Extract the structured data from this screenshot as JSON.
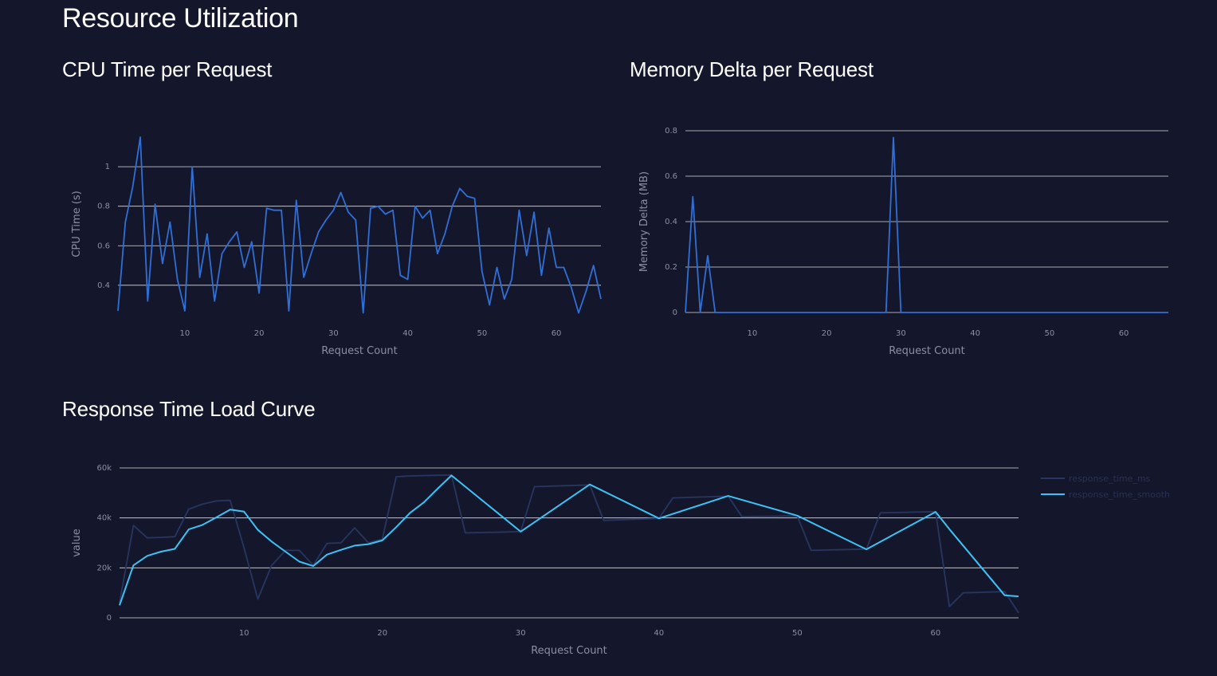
{
  "page": {
    "title": "Resource Utilization"
  },
  "colors": {
    "background": "#14172b",
    "grid": "#ffffff",
    "tick_text": "#8a8fa3",
    "cpu_line": "#2f6fd6",
    "memory_line": "#2f6fd6",
    "response_raw": "#27365f",
    "response_smooth": "#3cc3f5"
  },
  "panels": {
    "cpu": {
      "title": "CPU Time per Request"
    },
    "memory": {
      "title": "Memory Delta per Request"
    },
    "response": {
      "title": "Response Time Load Curve"
    }
  },
  "chart_data": [
    {
      "id": "cpu",
      "type": "line",
      "title": "CPU Time per Request",
      "xlabel": "Request Count",
      "ylabel": "CPU Time (s)",
      "xlim": [
        1,
        66
      ],
      "ylim": [
        0.27,
        1.15
      ],
      "xticks": [
        10,
        20,
        30,
        40,
        50,
        60
      ],
      "yticks": [
        0.4,
        0.6,
        0.8,
        1
      ],
      "ytick_labels": [
        "0.4",
        "0.6",
        "0.8",
        "1"
      ],
      "grid": true,
      "series": [
        {
          "color": "#2f6fd6",
          "x": [
            1,
            2,
            3,
            4,
            5,
            6,
            7,
            8,
            9,
            10,
            11,
            12,
            13,
            14,
            15,
            16,
            17,
            18,
            19,
            20,
            21,
            22,
            23,
            24,
            25,
            26,
            27,
            28,
            29,
            30,
            31,
            32,
            33,
            34,
            35,
            36,
            37,
            38,
            39,
            40,
            41,
            42,
            43,
            44,
            45,
            46,
            47,
            48,
            49,
            50,
            51,
            52,
            53,
            54,
            55,
            56,
            57,
            58,
            59,
            60,
            61,
            62,
            63,
            64,
            65,
            66
          ],
          "y": [
            0.27,
            0.72,
            0.9,
            1.15,
            0.32,
            0.81,
            0.51,
            0.72,
            0.43,
            0.27,
            1.0,
            0.44,
            0.66,
            0.32,
            0.56,
            0.62,
            0.67,
            0.49,
            0.62,
            0.36,
            0.79,
            0.78,
            0.78,
            0.27,
            0.83,
            0.44,
            0.56,
            0.67,
            0.73,
            0.78,
            0.87,
            0.77,
            0.73,
            0.26,
            0.79,
            0.8,
            0.76,
            0.78,
            0.45,
            0.43,
            0.8,
            0.74,
            0.78,
            0.56,
            0.66,
            0.8,
            0.89,
            0.85,
            0.84,
            0.47,
            0.3,
            0.49,
            0.33,
            0.43,
            0.78,
            0.55,
            0.77,
            0.45,
            0.69,
            0.49,
            0.49,
            0.39,
            0.26,
            0.37,
            0.5,
            0.33
          ]
        }
      ]
    },
    {
      "id": "memory",
      "type": "line",
      "title": "Memory Delta per Request",
      "xlabel": "Request Count",
      "ylabel": "Memory Delta (MB)",
      "xlim": [
        1,
        66
      ],
      "ylim": [
        0,
        0.8
      ],
      "xticks": [
        10,
        20,
        30,
        40,
        50,
        60
      ],
      "yticks": [
        0,
        0.2,
        0.4,
        0.6,
        0.8
      ],
      "ytick_labels": [
        "0",
        "0.2",
        "0.4",
        "0.6",
        "0.8"
      ],
      "grid": true,
      "series": [
        {
          "color": "#2f6fd6",
          "x": [
            1,
            2,
            3,
            4,
            5,
            6,
            7,
            8,
            9,
            10,
            11,
            12,
            13,
            14,
            15,
            16,
            17,
            18,
            19,
            20,
            21,
            22,
            23,
            24,
            25,
            26,
            27,
            28,
            29,
            30,
            31,
            32,
            33,
            34,
            35,
            36,
            37,
            38,
            39,
            40,
            41,
            42,
            43,
            44,
            45,
            46,
            47,
            48,
            49,
            50,
            51,
            52,
            53,
            54,
            55,
            56,
            57,
            58,
            59,
            60,
            61,
            62,
            63,
            64,
            65,
            66
          ],
          "y": [
            0,
            0.51,
            0,
            0.25,
            0,
            0,
            0,
            0,
            0,
            0,
            0,
            0,
            0,
            0,
            0,
            0,
            0,
            0,
            0,
            0,
            0,
            0,
            0,
            0,
            0,
            0,
            0,
            0,
            0.77,
            0,
            0,
            0,
            0,
            0,
            0,
            0,
            0,
            0,
            0,
            0,
            0,
            0,
            0,
            0,
            0,
            0,
            0,
            0,
            0,
            0,
            0,
            0,
            0,
            0,
            0,
            0,
            0,
            0,
            0,
            0,
            0,
            0,
            0,
            0,
            0,
            0
          ]
        }
      ]
    },
    {
      "id": "response",
      "type": "line",
      "title": "Response Time Load Curve",
      "xlabel": "Request Count",
      "ylabel": "value",
      "xlim": [
        1,
        66
      ],
      "ylim": [
        0,
        60000
      ],
      "xticks": [
        10,
        20,
        30,
        40,
        50,
        60
      ],
      "yticks": [
        0,
        20000,
        40000,
        60000
      ],
      "ytick_labels": [
        "0",
        "20k",
        "40k",
        "60k"
      ],
      "grid": true,
      "legend": "right",
      "series": [
        {
          "name": "response_time_ms",
          "color": "#27365f",
          "x": [
            1,
            2,
            3,
            4,
            5,
            6,
            7,
            8,
            9,
            10,
            11,
            12,
            13,
            14,
            15,
            16,
            17,
            18,
            19,
            20,
            21,
            22,
            25,
            26,
            30,
            31,
            35,
            36,
            40,
            41,
            45,
            46,
            50,
            51,
            55,
            56,
            60,
            61,
            62,
            65,
            66
          ],
          "y": [
            6000,
            37000,
            32000,
            32200,
            32500,
            43500,
            45500,
            46800,
            47000,
            28000,
            7500,
            21000,
            27000,
            27000,
            21000,
            29800,
            30000,
            36000,
            30000,
            31500,
            56500,
            56800,
            57200,
            34000,
            34500,
            52500,
            53200,
            39000,
            39800,
            48000,
            48700,
            40500,
            40800,
            27000,
            27500,
            42000,
            42500,
            4500,
            10000,
            10500,
            2000
          ]
        },
        {
          "name": "response_time_smooth",
          "color": "#3cc3f5",
          "x": [
            1,
            2,
            3,
            4,
            5,
            6,
            7,
            8,
            9,
            10,
            11,
            12,
            13,
            14,
            15,
            16,
            17,
            18,
            19,
            20,
            21,
            22,
            23,
            24,
            25,
            30,
            35,
            40,
            45,
            50,
            55,
            60,
            61,
            65,
            66
          ],
          "y": [
            5000,
            21000,
            24800,
            26500,
            27600,
            35400,
            37200,
            40200,
            43300,
            42500,
            35200,
            30500,
            26500,
            22500,
            20700,
            25300,
            27200,
            28900,
            29500,
            31000,
            36300,
            42000,
            46200,
            51700,
            57000,
            34500,
            53400,
            39800,
            48800,
            40900,
            27400,
            42400,
            35500,
            9000,
            8600
          ]
        }
      ]
    }
  ]
}
